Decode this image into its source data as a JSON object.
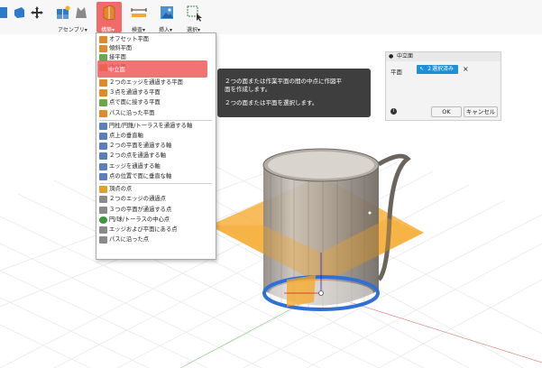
{
  "toolbar": {
    "assembly_label": "アセンブリ▾",
    "construct_label": "構築▾",
    "inspect_label": "検査▾",
    "insert_label": "挿入▾",
    "select_label": "選択▾"
  },
  "menu": {
    "items": [
      {
        "label": "オフセット平面",
        "icon": "offset-plane-icon",
        "color": "#e08a2a"
      },
      {
        "label": "傾斜平面",
        "icon": "angle-plane-icon",
        "color": "#e08a2a"
      },
      {
        "label": "接平面",
        "icon": "tangent-plane-icon",
        "color": "#6aa84f"
      },
      {
        "label": "中立面",
        "icon": "midplane-icon",
        "color": "#e08a2a"
      },
      {
        "label": "２つのエッジを通過する平面",
        "icon": "plane-two-edges-icon",
        "color": "#e08a2a"
      },
      {
        "label": "３点を通過する平面",
        "icon": "plane-three-points-icon",
        "color": "#e08a2a"
      },
      {
        "label": "点で面に接する平面",
        "icon": "plane-tangent-point-icon",
        "color": "#6aa84f"
      },
      {
        "label": "パスに沿った平面",
        "icon": "plane-along-path-icon",
        "color": "#e08a2a"
      },
      {
        "label": "円柱/円錐/トーラスを通過する軸",
        "icon": "axis-cylinder-icon",
        "color": "#5b7fb8"
      },
      {
        "label": "点上の垂直軸",
        "icon": "axis-perpendicular-icon",
        "color": "#5b7fb8"
      },
      {
        "label": "２つの平面を通過する軸",
        "icon": "axis-two-planes-icon",
        "color": "#5b7fb8"
      },
      {
        "label": "２つの点を通過する軸",
        "icon": "axis-two-points-icon",
        "color": "#5b7fb8"
      },
      {
        "label": "エッジを通過する軸",
        "icon": "axis-edge-icon",
        "color": "#5b7fb8"
      },
      {
        "label": "点の位置で面に垂直な軸",
        "icon": "axis-normal-face-icon",
        "color": "#5b7fb8"
      },
      {
        "label": "頂点の点",
        "icon": "point-vertex-icon",
        "color": "#e0a030"
      },
      {
        "label": "２つのエッジの通過点",
        "icon": "point-two-edges-icon",
        "color": "#8a8a8a"
      },
      {
        "label": "３つの平面が通過する点",
        "icon": "point-three-planes-icon",
        "color": "#8a8a8a"
      },
      {
        "label": "円/球/トーラスの中心点",
        "icon": "point-center-icon",
        "color": "#3a9a3a"
      },
      {
        "label": "エッジおよび平面にある点",
        "icon": "point-edge-plane-icon",
        "color": "#8a8a8a"
      },
      {
        "label": "パスに沿った点",
        "icon": "point-along-path-icon",
        "color": "#8a8a8a"
      }
    ]
  },
  "tooltip": {
    "line1": "２つの面または作業平面の間の中点に作図平",
    "line2": "面を作成します。",
    "line3": "２つの面または平面を選択します。"
  },
  "dialog": {
    "title": "中立面",
    "plane_label": "平面",
    "selection_value": "２選択済み",
    "ok_label": "OK",
    "cancel_label": "キャンセル",
    "colors": {
      "accent": "#1e90d6"
    }
  },
  "colors": {
    "highlight": "#f05a5a",
    "plane": "#f5a623",
    "edge_select": "#2f6fd6"
  }
}
